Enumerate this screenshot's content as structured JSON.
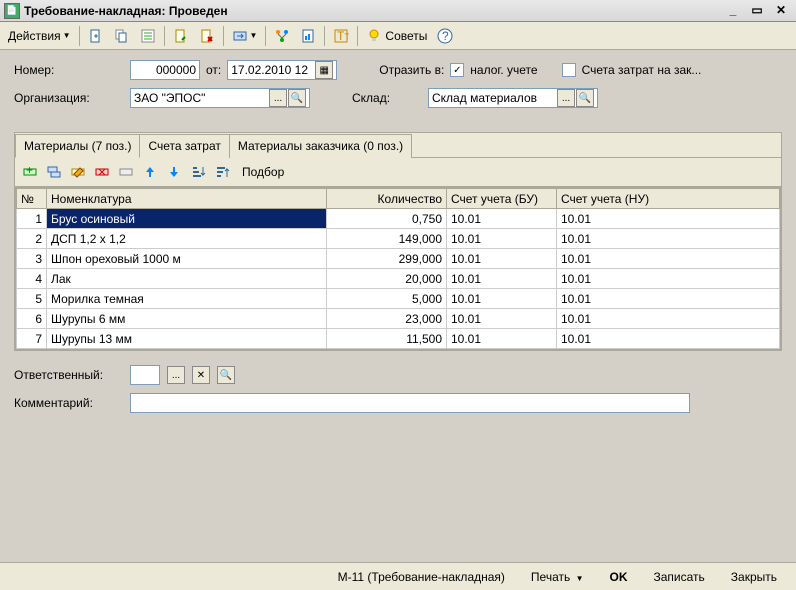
{
  "window": {
    "title": "Требование-накладная: Проведен"
  },
  "toolbar": {
    "actions_label": "Действия",
    "tips_label": "Советы"
  },
  "form": {
    "number_label": "Номер:",
    "number_value": "000000",
    "from_label": "от:",
    "date_value": "17.02.2010 12",
    "org_label": "Организация:",
    "org_value": "ЗАО \"ЭПОС\"",
    "reflect_label": "Отразить в:",
    "nalog_label": "налог. учете",
    "zatrat_label": "Счета затрат на зак...",
    "sklad_label": "Склад:",
    "sklad_value": "Склад материалов",
    "responsible_label": "Ответственный:",
    "comment_label": "Комментарий:"
  },
  "tabs": {
    "materials": "Материалы (7 поз.)",
    "accounts": "Счета затрат",
    "customer_materials": "Материалы заказчика (0 поз.)"
  },
  "tab_toolbar": {
    "podbor": "Подбор"
  },
  "table": {
    "headers": {
      "num": "№",
      "nomenclature": "Номенклатура",
      "quantity": "Количество",
      "account_bu": "Счет учета (БУ)",
      "account_nu": "Счет учета (НУ)"
    },
    "rows": [
      {
        "num": "1",
        "nom": "Брус осиновый",
        "qty": "0,750",
        "bu": "10.01",
        "nu": "10.01"
      },
      {
        "num": "2",
        "nom": "ДСП 1,2 x 1,2",
        "qty": "149,000",
        "bu": "10.01",
        "nu": "10.01"
      },
      {
        "num": "3",
        "nom": "Шпон ореховый 1000 м",
        "qty": "299,000",
        "bu": "10.01",
        "nu": "10.01"
      },
      {
        "num": "4",
        "nom": "Лак",
        "qty": "20,000",
        "bu": "10.01",
        "nu": "10.01"
      },
      {
        "num": "5",
        "nom": "Морилка темная",
        "qty": "5,000",
        "bu": "10.01",
        "nu": "10.01"
      },
      {
        "num": "6",
        "nom": "Шурупы 6 мм",
        "qty": "23,000",
        "bu": "10.01",
        "nu": "10.01"
      },
      {
        "num": "7",
        "nom": "Шурупы 13 мм",
        "qty": "11,500",
        "bu": "10.01",
        "nu": "10.01"
      }
    ]
  },
  "bottom": {
    "m11": "М-11 (Требование-накладная)",
    "print": "Печать",
    "ok": "OK",
    "save": "Записать",
    "close": "Закрыть"
  }
}
